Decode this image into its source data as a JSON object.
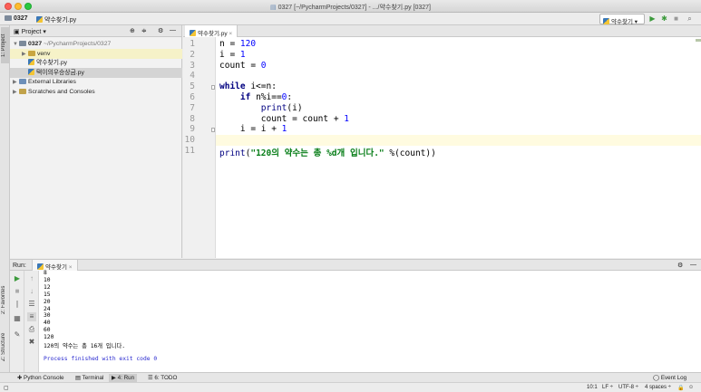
{
  "window": {
    "title": "0327 [~/PycharmProjects/0327] - .../약수찾기.py [0327]"
  },
  "navbar": {
    "project_crumb": "0327",
    "file_crumb": "약수찾기.py",
    "run_config": "약수찾기"
  },
  "left_strip": {
    "project_tab": "1: Project",
    "favorites_tab": "2: Favorites",
    "structure_tab": "Z: Structure"
  },
  "project_panel": {
    "header": "Project",
    "tree": [
      {
        "label": "0327",
        "suffix": "~/PycharmProjects/0327",
        "level": 0,
        "expanded": true,
        "kind": "folder",
        "state": ""
      },
      {
        "label": "venv",
        "suffix": "",
        "level": 1,
        "expanded": false,
        "kind": "folder",
        "state": "highlight"
      },
      {
        "label": "약수찾기.py",
        "suffix": "",
        "level": 1,
        "kind": "py",
        "state": ""
      },
      {
        "label": "택이의우승상금.py",
        "suffix": "",
        "level": 1,
        "kind": "py",
        "state": "selected"
      },
      {
        "label": "External Libraries",
        "suffix": "",
        "level": 0,
        "expanded": false,
        "kind": "lib",
        "state": ""
      },
      {
        "label": "Scratches and Consoles",
        "suffix": "",
        "level": 0,
        "expanded": false,
        "kind": "scratch",
        "state": ""
      }
    ]
  },
  "editor": {
    "tab": "약수찾기.py",
    "current_line": 10,
    "lines": [
      {
        "n": "1",
        "code": "n = 120"
      },
      {
        "n": "2",
        "code": "i = 1"
      },
      {
        "n": "3",
        "code": "count = 0"
      },
      {
        "n": "4",
        "code": ""
      },
      {
        "n": "5",
        "code": "while i<=n:"
      },
      {
        "n": "6",
        "code": "    if n%i==0:"
      },
      {
        "n": "7",
        "code": "        print(i)"
      },
      {
        "n": "8",
        "code": "        count = count + 1"
      },
      {
        "n": "9",
        "code": "    i = i + 1"
      },
      {
        "n": "10",
        "code": ""
      },
      {
        "n": "11",
        "code": "print(\"120의 약수는 총 %d개 입니다.\" %(count))"
      }
    ]
  },
  "run_panel": {
    "label": "Run:",
    "tab": "약수찾기",
    "output": [
      "8",
      "10",
      "12",
      "15",
      "20",
      "24",
      "30",
      "40",
      "60",
      "120",
      "120의 약수는 총 16개 입니다.",
      "",
      "Process finished with exit code 0"
    ]
  },
  "bottom_tabs": [
    "Python Console",
    "Terminal",
    "4: Run",
    "6: TODO"
  ],
  "event_log": "Event Log",
  "status": {
    "position": "10:1",
    "line_sep": "LF ÷",
    "encoding": "UTF-8 ÷",
    "indent": "4 spaces ÷"
  },
  "colors": {
    "keyword": "#000080",
    "number": "#0000ff",
    "string": "#067d17",
    "current_line": "#fffbe0",
    "run_green": "#3c9a3c"
  }
}
